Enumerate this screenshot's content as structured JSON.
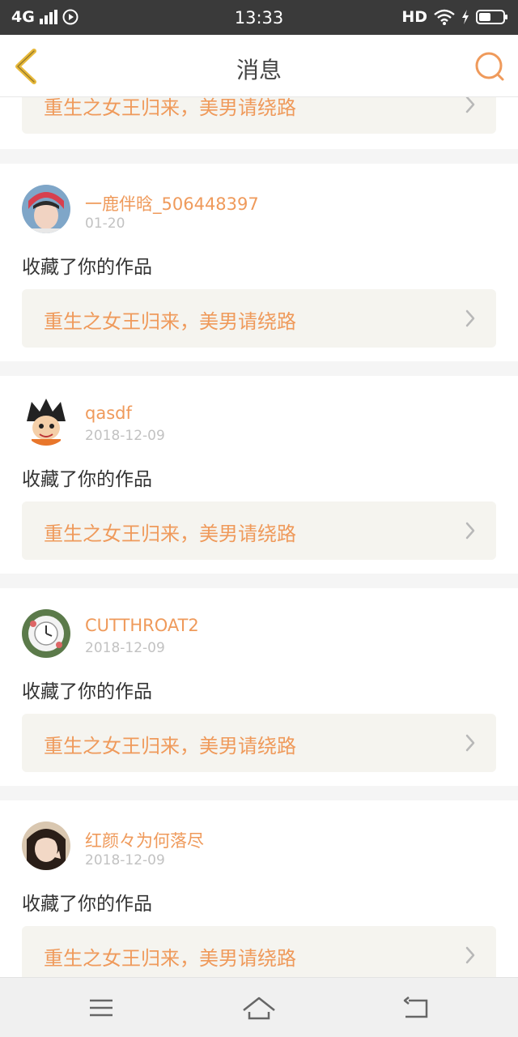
{
  "status_bar": {
    "network": "4G",
    "time": "13:33",
    "hd": "HD"
  },
  "header": {
    "title": "消息",
    "back_icon": "chevron-left-icon",
    "search_icon": "search-icon"
  },
  "top_partial_card": {
    "work_title": "重生之女王归来，美男请绕路"
  },
  "messages": [
    {
      "username": "一鹿伴晗_506448397",
      "date": "01-20",
      "action": "收藏了你的作品",
      "work_title": "重生之女王归来，美男请绕路"
    },
    {
      "username": "qasdf",
      "date": "2018-12-09",
      "action": "收藏了你的作品",
      "work_title": "重生之女王归来，美男请绕路"
    },
    {
      "username": "CUTTHROAT2",
      "date": "2018-12-09",
      "action": "收藏了你的作品",
      "work_title": "重生之女王归来，美男请绕路"
    },
    {
      "username": "红颜々为何落尽",
      "date": "2018-12-09",
      "action": "收藏了你的作品",
      "work_title": "重生之女王归来，美男请绕路"
    }
  ],
  "bottom_nav": {
    "menu_icon": "menu-icon",
    "home_icon": "home-icon",
    "back_icon": "back-icon"
  },
  "colors": {
    "accent": "#ef9a5b",
    "back_arrow": "#e8b93a",
    "work_box_bg": "#f5f4ef",
    "status_bar_bg": "#3a3a3a"
  }
}
